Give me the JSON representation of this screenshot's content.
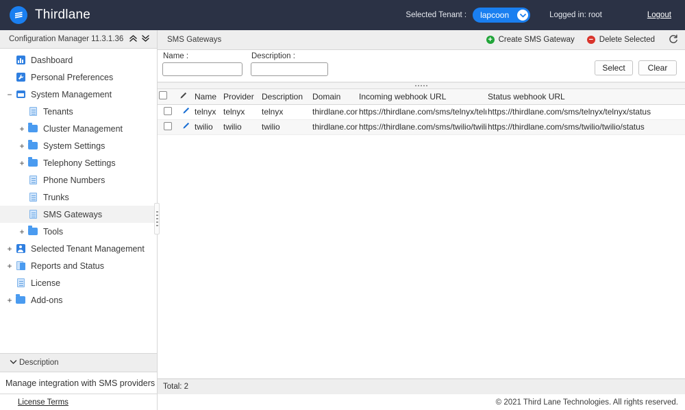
{
  "header": {
    "brand": "Thirdlane",
    "logo_icon": "thirdlane-logo-icon",
    "tenant_label": "Selected Tenant :",
    "tenant_value": "lapcoon",
    "tenant_caret_icon": "chevron-down-icon",
    "logged_in": "Logged in: root",
    "logout": "Logout",
    "bg_color": "#2b3245",
    "accent_color": "#1a7ff0"
  },
  "sidebar": {
    "title": "Configuration Manager 11.3.1.36",
    "collapse_all_icon": "chevrons-up-icon",
    "expand_all_icon": "chevrons-down-icon",
    "items": [
      {
        "label": "Dashboard",
        "icon": "dashboard-icon",
        "indent": 0,
        "twisty": "",
        "selected": false
      },
      {
        "label": "Personal Preferences",
        "icon": "preferences-icon",
        "indent": 0,
        "twisty": "",
        "selected": false
      },
      {
        "label": "System Management",
        "icon": "window-icon",
        "indent": 0,
        "twisty": "−",
        "selected": false
      },
      {
        "label": "Tenants",
        "icon": "document-icon",
        "indent": 1,
        "twisty": "",
        "selected": false
      },
      {
        "label": "Cluster Management",
        "icon": "folder-icon",
        "indent": 1,
        "twisty": "+",
        "selected": false
      },
      {
        "label": "System Settings",
        "icon": "folder-icon",
        "indent": 1,
        "twisty": "+",
        "selected": false
      },
      {
        "label": "Telephony Settings",
        "icon": "folder-icon",
        "indent": 1,
        "twisty": "+",
        "selected": false
      },
      {
        "label": "Phone Numbers",
        "icon": "document-icon",
        "indent": 1,
        "twisty": "",
        "selected": false
      },
      {
        "label": "Trunks",
        "icon": "document-icon",
        "indent": 1,
        "twisty": "",
        "selected": false
      },
      {
        "label": "SMS Gateways",
        "icon": "document-icon",
        "indent": 1,
        "twisty": "",
        "selected": true
      },
      {
        "label": "Tools",
        "icon": "folder-icon",
        "indent": 1,
        "twisty": "+",
        "selected": false
      },
      {
        "label": "Selected Tenant Management",
        "icon": "person-icon",
        "indent": 0,
        "twisty": "+",
        "selected": false
      },
      {
        "label": "Reports and Status",
        "icon": "reports-icon",
        "indent": 0,
        "twisty": "+",
        "selected": false
      },
      {
        "label": "License",
        "icon": "document-icon",
        "indent": 0,
        "twisty": "",
        "selected": false
      },
      {
        "label": "Add-ons",
        "icon": "folder-icon",
        "indent": 0,
        "twisty": "+",
        "selected": false
      }
    ],
    "description_header": "Description",
    "description_chevron_icon": "chevron-down-icon",
    "description_text": "Manage integration with SMS providers",
    "license_terms": "License Terms"
  },
  "main": {
    "title": "SMS Gateways",
    "create_label": "Create SMS Gateway",
    "create_icon": "plus-circle-icon",
    "delete_label": "Delete Selected",
    "delete_icon": "minus-circle-icon",
    "refresh_icon": "refresh-icon",
    "filters": {
      "name_label": "Name :",
      "name_value": "",
      "name_placeholder": "",
      "description_label": "Description :",
      "description_value": "",
      "description_placeholder": "",
      "select_label": "Select",
      "clear_label": "Clear"
    },
    "grid": {
      "columns": [
        "",
        "",
        "Name",
        "Provider",
        "Description",
        "Domain",
        "Incoming webhook URL",
        "Status webhook URL"
      ],
      "header_edit_icon": "pencil-icon",
      "rows": [
        {
          "checked": false,
          "edit_icon": "pencil-icon",
          "name": "telnyx",
          "provider": "telnyx",
          "description": "telnyx",
          "domain": "thirdlane.com",
          "incoming_webhook_url": "https://thirdlane.com/sms/telnyx/telnyx",
          "status_webhook_url": "https://thirdlane.com/sms/telnyx/telnyx/status"
        },
        {
          "checked": false,
          "edit_icon": "pencil-icon",
          "name": "twilio",
          "provider": "twilio",
          "description": "twilio",
          "domain": "thirdlane.com",
          "incoming_webhook_url": "https://thirdlane.com/sms/twilio/twilio",
          "status_webhook_url": "https://thirdlane.com/sms/twilio/twilio/status"
        }
      ]
    },
    "total": "Total: 2"
  },
  "footer": {
    "copyright": "© 2021 Third Lane Technologies. All rights reserved."
  }
}
